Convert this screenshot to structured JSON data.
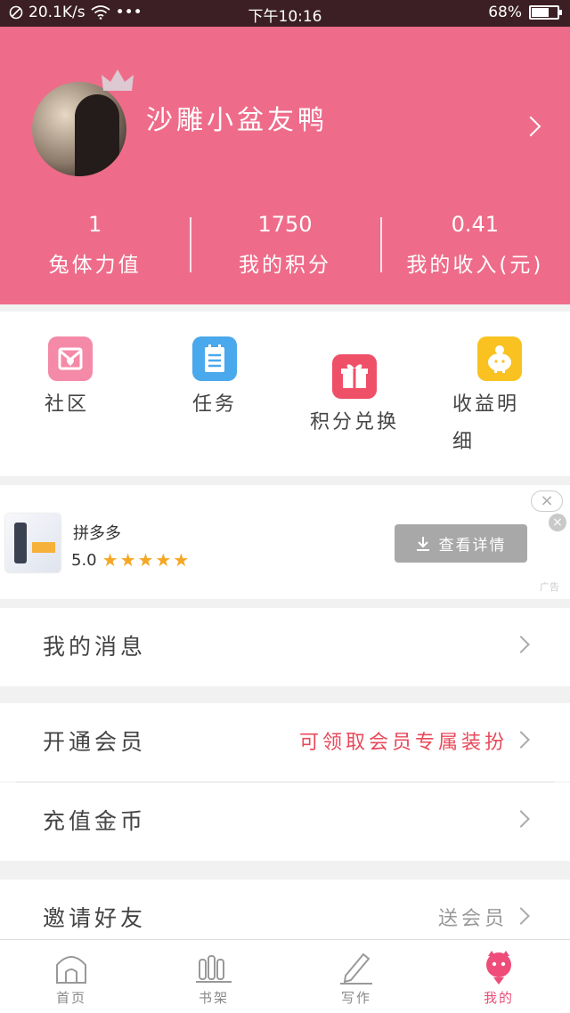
{
  "status_bar": {
    "speed": "20.1K/s",
    "dots": "•••",
    "time": "下午10:16",
    "battery": "68%",
    "battery_level": 0.68
  },
  "profile": {
    "username": "沙雕小盆友鸭",
    "stats": [
      {
        "value": "1",
        "label": "兔体力值"
      },
      {
        "value": "1750",
        "label": "我的积分"
      },
      {
        "value": "0.41",
        "label": "我的收入(元)"
      }
    ]
  },
  "quick_menu": {
    "community": "社区",
    "tasks": "任务",
    "points_exchange": "积分兑换",
    "earnings_detail_1": "收益明",
    "earnings_detail_2": "细"
  },
  "ad": {
    "app_name": "拼多多",
    "rating": "5.0",
    "stars": "★★★★★",
    "button": "查看详情",
    "close": "×",
    "mark": "广告"
  },
  "menu": {
    "messages": "我的消息",
    "vip": "开通会员",
    "vip_extra": "可领取会员专属装扮",
    "recharge": "充值金币",
    "invite": "邀请好友",
    "invite_extra": "送会员"
  },
  "tabs": [
    {
      "label": "首页",
      "active": false
    },
    {
      "label": "书架",
      "active": false
    },
    {
      "label": "写作",
      "active": false
    },
    {
      "label": "我的",
      "active": true
    }
  ],
  "colors": {
    "brand": "#ee6c8a",
    "accent_red": "#e8495a",
    "tab_active": "#ee4d79"
  }
}
